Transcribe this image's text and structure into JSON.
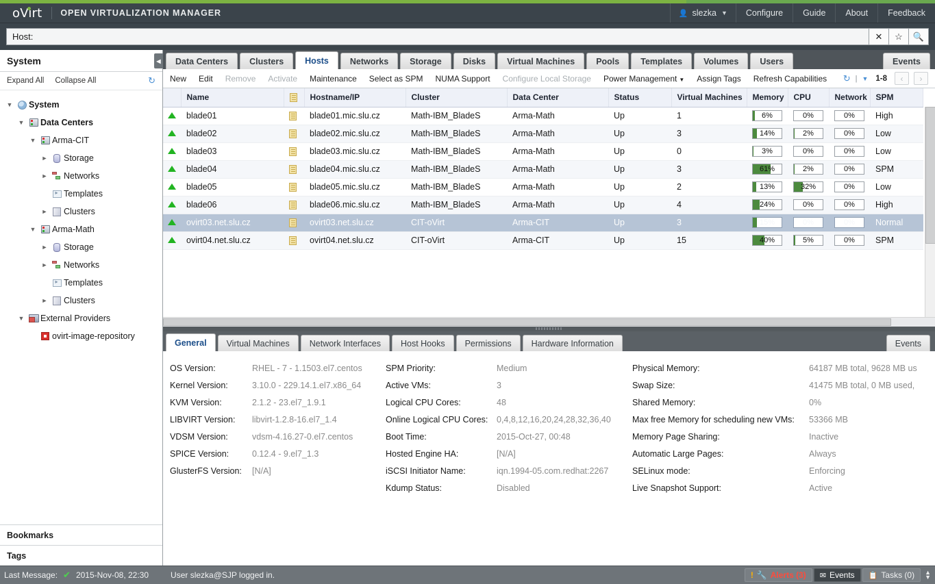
{
  "brand": {
    "logo": "oVirt",
    "title": "OPEN VIRTUALIZATION MANAGER"
  },
  "header_nav": {
    "user": "slezka",
    "items": [
      "Configure",
      "Guide",
      "About",
      "Feedback"
    ]
  },
  "search": {
    "value": "Host:",
    "placeholder": "",
    "clear_icon": "✕",
    "bookmark_icon": "☆",
    "search_icon": "⚲"
  },
  "main_tabs": {
    "items": [
      "Data Centers",
      "Clusters",
      "Hosts",
      "Networks",
      "Storage",
      "Disks",
      "Virtual Machines",
      "Pools",
      "Templates",
      "Volumes",
      "Users"
    ],
    "active": "Hosts",
    "events_label": "Events"
  },
  "toolbar": {
    "actions": [
      {
        "label": "New",
        "disabled": false,
        "caret": false
      },
      {
        "label": "Edit",
        "disabled": false,
        "caret": false
      },
      {
        "label": "Remove",
        "disabled": true,
        "caret": false
      },
      {
        "label": "Activate",
        "disabled": true,
        "caret": false
      },
      {
        "label": "Maintenance",
        "disabled": false,
        "caret": false
      },
      {
        "label": "Select as SPM",
        "disabled": false,
        "caret": false
      },
      {
        "label": "NUMA Support",
        "disabled": false,
        "caret": false
      },
      {
        "label": "Configure Local Storage",
        "disabled": true,
        "caret": false
      },
      {
        "label": "Power Management",
        "disabled": false,
        "caret": true
      },
      {
        "label": "Assign Tags",
        "disabled": false,
        "caret": false
      },
      {
        "label": "Refresh Capabilities",
        "disabled": false,
        "caret": false
      }
    ],
    "refresh_icon": "⟳",
    "page_range": "1-8",
    "prev_icon": "‹",
    "next_icon": "›"
  },
  "sidebar": {
    "title": "System",
    "expand_all": "Expand All",
    "collapse_all": "Collapse All",
    "refresh_icon": "⟳",
    "collapse_tab_icon": "◀",
    "tree": [
      {
        "label": "System",
        "indent": 0,
        "arrow": "▼",
        "icon": "globe-icon",
        "bold": true
      },
      {
        "label": "Data Centers",
        "indent": 1,
        "arrow": "▼",
        "icon": "datacenter-icon",
        "bold": true
      },
      {
        "label": "Arma-CIT",
        "indent": 2,
        "arrow": "▼",
        "icon": "datacenter-icon",
        "bold": false
      },
      {
        "label": "Storage",
        "indent": 3,
        "arrow": "►",
        "icon": "storage-icon",
        "bold": false
      },
      {
        "label": "Networks",
        "indent": 3,
        "arrow": "►",
        "icon": "network-icon",
        "bold": false
      },
      {
        "label": "Templates",
        "indent": 3,
        "arrow": "",
        "icon": "template-icon",
        "bold": false
      },
      {
        "label": "Clusters",
        "indent": 3,
        "arrow": "►",
        "icon": "cluster-icon",
        "bold": false
      },
      {
        "label": "Arma-Math",
        "indent": 2,
        "arrow": "▼",
        "icon": "datacenter-icon",
        "bold": false
      },
      {
        "label": "Storage",
        "indent": 3,
        "arrow": "►",
        "icon": "storage-icon",
        "bold": false
      },
      {
        "label": "Networks",
        "indent": 3,
        "arrow": "►",
        "icon": "network-icon",
        "bold": false
      },
      {
        "label": "Templates",
        "indent": 3,
        "arrow": "",
        "icon": "template-icon",
        "bold": false
      },
      {
        "label": "Clusters",
        "indent": 3,
        "arrow": "►",
        "icon": "cluster-icon",
        "bold": false
      },
      {
        "label": "External Providers",
        "indent": 1,
        "arrow": "▼",
        "icon": "external-provider-icon",
        "bold": false
      },
      {
        "label": "ovirt-image-repository",
        "indent": 2,
        "arrow": "",
        "icon": "repository-icon",
        "bold": false
      }
    ],
    "bookmarks": "Bookmarks",
    "tags": "Tags"
  },
  "grid": {
    "columns": [
      "",
      "Name",
      "",
      "Hostname/IP",
      "Cluster",
      "Data Center",
      "Status",
      "Virtual Machines",
      "Memory",
      "CPU",
      "Network",
      "SPM"
    ],
    "rows": [
      {
        "status_icon": "up-arrow-icon",
        "name": "blade01",
        "doc": true,
        "hostname": "blade01.mic.slu.cz",
        "cluster": "Math-IBM_BladeS",
        "datacenter": "Arma-Math",
        "status": "Up",
        "vms": "1",
        "memory": "6%",
        "cpu": "0%",
        "network": "0%",
        "spm": "High",
        "selected": false
      },
      {
        "status_icon": "up-arrow-icon",
        "name": "blade02",
        "doc": true,
        "hostname": "blade02.mic.slu.cz",
        "cluster": "Math-IBM_BladeS",
        "datacenter": "Arma-Math",
        "status": "Up",
        "vms": "3",
        "memory": "14%",
        "cpu": "2%",
        "network": "0%",
        "spm": "Low",
        "selected": false
      },
      {
        "status_icon": "up-arrow-icon",
        "name": "blade03",
        "doc": true,
        "hostname": "blade03.mic.slu.cz",
        "cluster": "Math-IBM_BladeS",
        "datacenter": "Arma-Math",
        "status": "Up",
        "vms": "0",
        "memory": "3%",
        "cpu": "0%",
        "network": "0%",
        "spm": "Low",
        "selected": false
      },
      {
        "status_icon": "up-arrow-icon",
        "name": "blade04",
        "doc": true,
        "hostname": "blade04.mic.slu.cz",
        "cluster": "Math-IBM_BladeS",
        "datacenter": "Arma-Math",
        "status": "Up",
        "vms": "3",
        "memory": "61%",
        "cpu": "2%",
        "network": "0%",
        "spm": "SPM",
        "selected": false
      },
      {
        "status_icon": "up-arrow-icon",
        "name": "blade05",
        "doc": true,
        "hostname": "blade05.mic.slu.cz",
        "cluster": "Math-IBM_BladeS",
        "datacenter": "Arma-Math",
        "status": "Up",
        "vms": "2",
        "memory": "13%",
        "cpu": "32%",
        "network": "0%",
        "spm": "Low",
        "selected": false
      },
      {
        "status_icon": "up-arrow-icon",
        "name": "blade06",
        "doc": true,
        "hostname": "blade06.mic.slu.cz",
        "cluster": "Math-IBM_BladeS",
        "datacenter": "Arma-Math",
        "status": "Up",
        "vms": "4",
        "memory": "24%",
        "cpu": "0%",
        "network": "0%",
        "spm": "High",
        "selected": false
      },
      {
        "status_icon": "up-arrow-icon",
        "name": "ovirt03.net.slu.cz",
        "doc": true,
        "hostname": "ovirt03.net.slu.cz",
        "cluster": "CIT-oVirt",
        "datacenter": "Arma-CIT",
        "status": "Up",
        "vms": "3",
        "memory": "15%",
        "cpu": "0%",
        "network": "0%",
        "spm": "Normal",
        "selected": true
      },
      {
        "status_icon": "up-arrow-icon",
        "name": "ovirt04.net.slu.cz",
        "doc": true,
        "hostname": "ovirt04.net.slu.cz",
        "cluster": "CIT-oVirt",
        "datacenter": "Arma-CIT",
        "status": "Up",
        "vms": "15",
        "memory": "40%",
        "cpu": "5%",
        "network": "0%",
        "spm": "SPM",
        "selected": false
      }
    ]
  },
  "detail": {
    "tabs": [
      "General",
      "Virtual Machines",
      "Network Interfaces",
      "Host Hooks",
      "Permissions",
      "Hardware Information"
    ],
    "active": "General",
    "events_label": "Events",
    "col1": [
      {
        "label": "OS Version:",
        "value": "RHEL - 7 - 1.1503.el7.centos"
      },
      {
        "label": "Kernel Version:",
        "value": "3.10.0 - 229.14.1.el7.x86_64"
      },
      {
        "label": "KVM Version:",
        "value": "2.1.2 - 23.el7_1.9.1"
      },
      {
        "label": "LIBVIRT Version:",
        "value": "libvirt-1.2.8-16.el7_1.4"
      },
      {
        "label": "VDSM Version:",
        "value": "vdsm-4.16.27-0.el7.centos"
      },
      {
        "label": "SPICE Version:",
        "value": "0.12.4 - 9.el7_1.3"
      },
      {
        "label": "GlusterFS Version:",
        "value": "[N/A]"
      }
    ],
    "col2": [
      {
        "label": "SPM Priority:",
        "value": "Medium"
      },
      {
        "label": "Active VMs:",
        "value": "3"
      },
      {
        "label": "Logical CPU Cores:",
        "value": "48"
      },
      {
        "label": "Online Logical CPU Cores:",
        "value": "0,4,8,12,16,20,24,28,32,36,40"
      },
      {
        "label": "Boot Time:",
        "value": "2015-Oct-27, 00:48"
      },
      {
        "label": "Hosted Engine HA:",
        "value": "[N/A]"
      },
      {
        "label": "iSCSI Initiator Name:",
        "value": "iqn.1994-05.com.redhat:2267"
      },
      {
        "label": "Kdump Status:",
        "value": "Disabled"
      }
    ],
    "col3": [
      {
        "label": "Physical Memory:",
        "value": "64187 MB total, 9628 MB us"
      },
      {
        "label": "Swap Size:",
        "value": "41475 MB total, 0 MB used,"
      },
      {
        "label": "Shared Memory:",
        "value": "0%"
      },
      {
        "label": "Max free Memory for scheduling new VMs:",
        "value": "53366 MB"
      },
      {
        "label": "Memory Page Sharing:",
        "value": "Inactive"
      },
      {
        "label": "Automatic Large Pages:",
        "value": "Always"
      },
      {
        "label": "SELinux mode:",
        "value": "Enforcing"
      },
      {
        "label": "Live Snapshot Support:",
        "value": "Active"
      }
    ]
  },
  "statusbar": {
    "last_message_label": "Last Message:",
    "check_icon": "✔",
    "timestamp": "2015-Nov-08, 22:30",
    "message": "User slezka@SJP logged in.",
    "alerts": "Alerts (3)",
    "events": "Events",
    "tasks": "Tasks (0)"
  },
  "colors": {
    "brand_green": "#7cb342",
    "header_dark": "#3b444b",
    "meter_green": "#4c8a3e",
    "selected_row": "#b6c4d6",
    "alert_red": "#ff4b3c",
    "link_blue": "#1b4e8a"
  }
}
